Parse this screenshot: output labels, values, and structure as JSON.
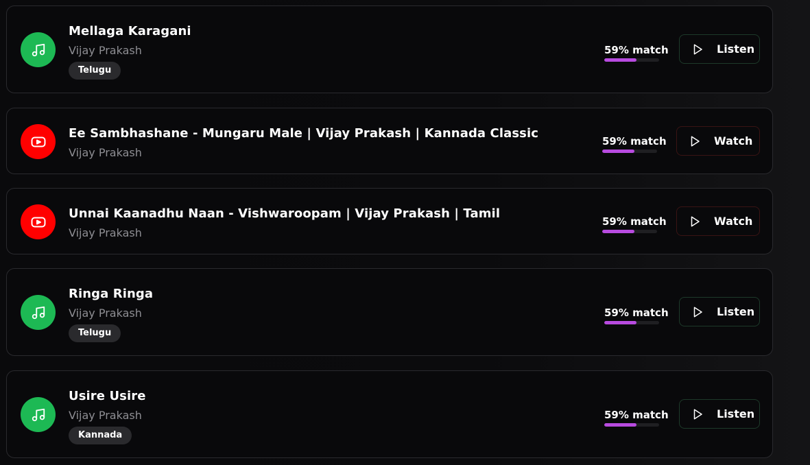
{
  "results": [
    {
      "source": "spotify",
      "icon": "music-note-icon",
      "title": "Mellaga Karagani",
      "artist": "Vijay Prakash",
      "language": "Telugu",
      "match_text": "59% match",
      "match_percent": 59,
      "action": "Listen"
    },
    {
      "source": "youtube",
      "icon": "youtube-icon",
      "title": "Ee Sambhashane - Mungaru Male | Vijay Prakash | Kannada Classic",
      "artist": "Vijay Prakash",
      "language": "",
      "match_text": "59% match",
      "match_percent": 59,
      "action": "Watch"
    },
    {
      "source": "youtube",
      "icon": "youtube-icon",
      "title": "Unnai Kaanadhu Naan - Vishwaroopam | Vijay Prakash | Tamil",
      "artist": "Vijay Prakash",
      "language": "",
      "match_text": "59% match",
      "match_percent": 59,
      "action": "Watch"
    },
    {
      "source": "spotify",
      "icon": "music-note-icon",
      "title": "Ringa Ringa",
      "artist": "Vijay Prakash",
      "language": "Telugu",
      "match_text": "59% match",
      "match_percent": 59,
      "action": "Listen"
    },
    {
      "source": "spotify",
      "icon": "music-note-icon",
      "title": "Usire Usire",
      "artist": "Vijay Prakash",
      "language": "Kannada",
      "match_text": "59% match",
      "match_percent": 59,
      "action": "Listen"
    }
  ],
  "colors": {
    "spotify_green": "#1db954",
    "youtube_red": "#ff0000",
    "match_fill": "#b84be0"
  }
}
